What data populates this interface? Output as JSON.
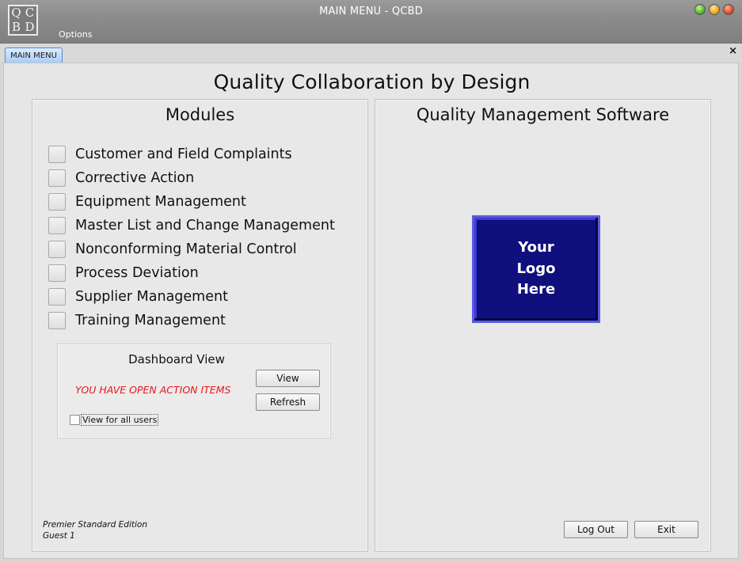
{
  "window": {
    "title": "MAIN MENU - QCBD",
    "logo_letters": [
      "Q",
      "C",
      "B",
      "D"
    ],
    "menu": {
      "options": "Options"
    },
    "controls": [
      "minimize-icon",
      "maximize-icon",
      "close-icon"
    ]
  },
  "tabs": {
    "active_label": "MAIN MENU",
    "close_glyph": "×"
  },
  "main": {
    "title": "Quality Collaboration by Design",
    "modules_panel": {
      "title": "Modules",
      "items": [
        "Customer and Field Complaints",
        "Corrective Action",
        "Equipment Management",
        "Master List and Change Management",
        "Nonconforming Material Control",
        "Process Deviation",
        "Supplier Management",
        "Training Management"
      ],
      "dashboard": {
        "title": "Dashboard View",
        "alert": "YOU HAVE OPEN ACTION ITEMS",
        "view_label": "View",
        "refresh_label": "Refresh",
        "all_users_label": "View for all users",
        "all_users_checked": false
      },
      "edition": "Premier Standard Edition",
      "user": "Guest 1"
    },
    "software_panel": {
      "title": "Quality Management Software",
      "logo_lines": [
        "Your",
        "Logo",
        "Here"
      ],
      "logout_label": "Log Out",
      "exit_label": "Exit"
    }
  },
  "colors": {
    "alert": "#e8161b",
    "logo_bg": "#0f0f7d",
    "tab_active": "#a9cdf6"
  }
}
